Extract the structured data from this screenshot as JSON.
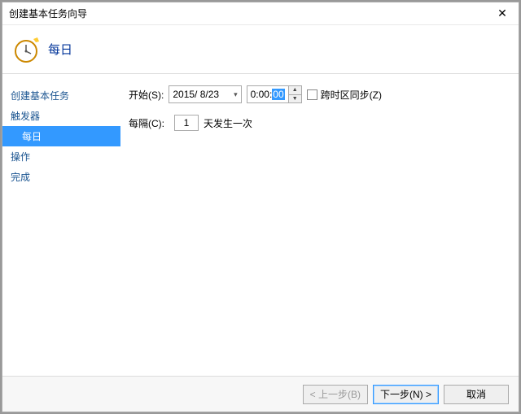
{
  "window": {
    "title": "创建基本任务向导"
  },
  "header": {
    "title": "每日"
  },
  "sidebar": {
    "items": [
      {
        "label": "创建基本任务"
      },
      {
        "label": "触发器"
      },
      {
        "label": "每日",
        "sub": true,
        "active": true
      },
      {
        "label": "操作"
      },
      {
        "label": "完成"
      }
    ]
  },
  "form": {
    "start_label": "开始(S):",
    "date_value": "2015/ 8/23",
    "time_prefix": "0:00:",
    "time_selected": "00",
    "tz_label": "跨时区同步(Z)",
    "recur_label": "每隔(C):",
    "recur_value": "1",
    "recur_suffix": "天发生一次"
  },
  "footer": {
    "back": "< 上一步(B)",
    "next": "下一步(N) >",
    "cancel": "取消"
  }
}
